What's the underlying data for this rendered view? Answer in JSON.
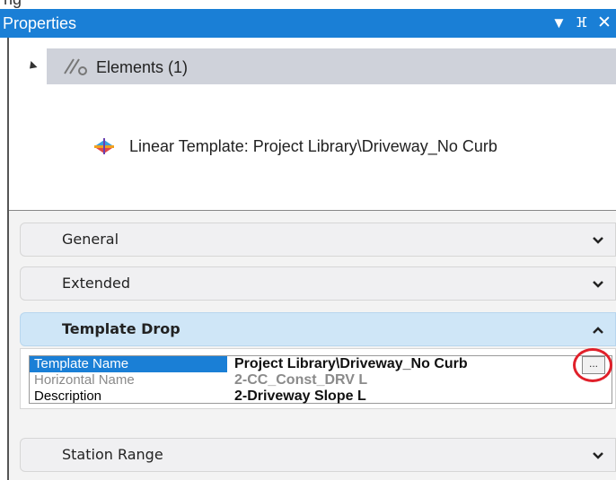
{
  "window": {
    "title": "Properties",
    "controls": {
      "dropdown": "▼",
      "pin": "ⴼ",
      "close": "✕"
    }
  },
  "tree": {
    "elements_label": "Elements (1)",
    "child_label": "Linear Template: Project Library\\Driveway_No Curb"
  },
  "sections": {
    "general": "General",
    "extended": "Extended",
    "template_drop": "Template Drop",
    "station_range": "Station Range"
  },
  "properties": [
    {
      "name": "Template Name",
      "value": "Project Library\\Driveway_No Curb",
      "state": "selected"
    },
    {
      "name": "Horizontal Name",
      "value": "2-CC_Const_DRV L",
      "state": "disabled"
    },
    {
      "name": "Description",
      "value": "2-Driveway Slope L",
      "state": "normal"
    }
  ],
  "browse_button": "...",
  "colors": {
    "title_bar": "#1a7fd6",
    "selection": "#1a7fd6",
    "section_expanded": "#cfe6f7",
    "highlight_circle": "#e0202a"
  }
}
